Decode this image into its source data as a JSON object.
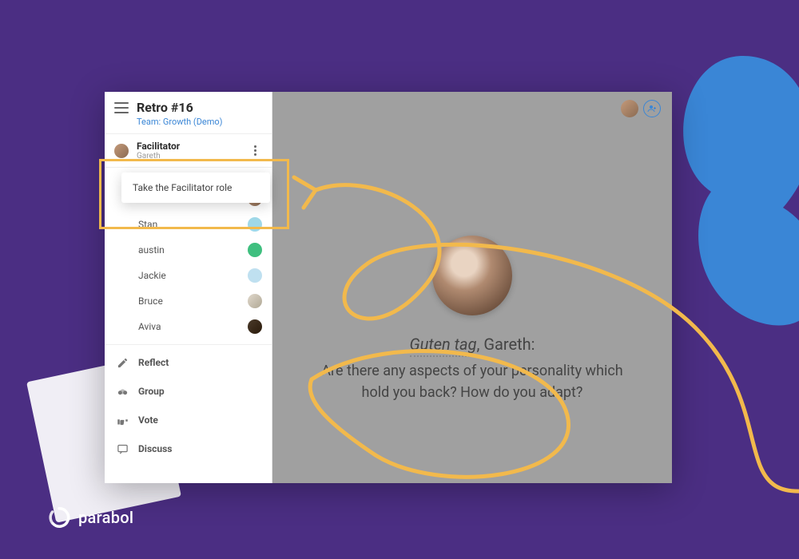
{
  "brand": {
    "name": "parabol"
  },
  "header": {
    "title": "Retro #16",
    "team_prefix": "Team: ",
    "team_name": "Growth (Demo)"
  },
  "facilitator": {
    "label": "Facilitator",
    "name": "Gareth"
  },
  "popover": {
    "action": "Take the Facilitator role"
  },
  "team": [
    {
      "name": "Gareth",
      "avatar_bg": "linear-gradient(135deg,#c49a7a,#8a6a52)"
    },
    {
      "name": "Stan",
      "avatar_bg": "#9fd8e8"
    },
    {
      "name": "austin",
      "avatar_bg": "#3fbf7f"
    },
    {
      "name": "Jackie",
      "avatar_bg": "#bfe0f0"
    },
    {
      "name": "Bruce",
      "avatar_bg": "linear-gradient(135deg,#e0d8cc,#b0a895)"
    },
    {
      "name": "Aviva",
      "avatar_bg": "linear-gradient(135deg,#4a3a2a,#2a1a0a)"
    }
  ],
  "phases": [
    {
      "icon": "edit",
      "label": "Reflect"
    },
    {
      "icon": "group",
      "label": "Group"
    },
    {
      "icon": "vote",
      "label": "Vote"
    },
    {
      "icon": "discuss",
      "label": "Discuss"
    }
  ],
  "main": {
    "greeting_phrase": "Guten tag",
    "greeting_name": "Gareth",
    "prompt_line1": "Are there any aspects of your personality which",
    "prompt_line2": "hold you back? How do you adapt?"
  },
  "colors": {
    "background": "#4b2e83",
    "accent": "#f2b94c",
    "blob": "#3a86d6"
  }
}
